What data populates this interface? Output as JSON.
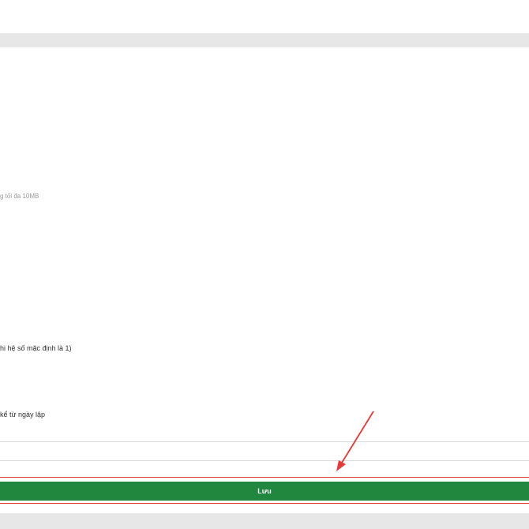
{
  "form": {
    "file_hint": "g tối đa 10MB",
    "coefficient_label": "hi hệ số mặc định là 1)",
    "date_label": "kể từ ngày lập",
    "save_label": "Lưu"
  },
  "colors": {
    "save_button": "#21873f",
    "highlight": "#e53935",
    "band": "#e7e7e7"
  },
  "icons": {
    "annotation_arrow": "red-arrow-icon"
  }
}
